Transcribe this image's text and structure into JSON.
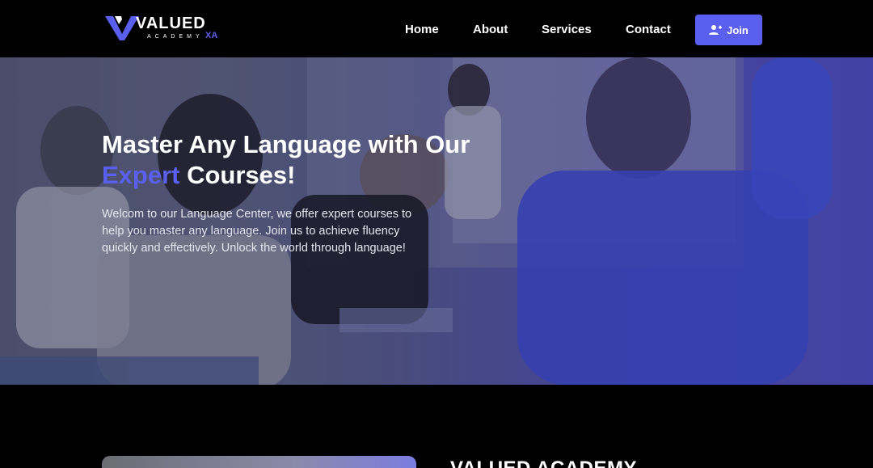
{
  "header": {
    "logo": {
      "word": "VALUED",
      "sub": "ACADEMY",
      "badge": "XA"
    },
    "nav": [
      {
        "label": "Home"
      },
      {
        "label": "About"
      },
      {
        "label": "Services"
      },
      {
        "label": "Contact"
      }
    ],
    "join_label": "Join"
  },
  "hero": {
    "title_line1": "Master Any Language with Our",
    "title_accent": "Expert",
    "title_rest": " Courses!",
    "text": "Welcom to our Language Center, we offer expert courses to help you master any language. Join us to achieve fluency quickly and effectively. Unlock the world through language!"
  },
  "about": {
    "title": "VALUED ACADEMY"
  },
  "colors": {
    "accent": "#5b5ff0",
    "background": "#000000"
  }
}
